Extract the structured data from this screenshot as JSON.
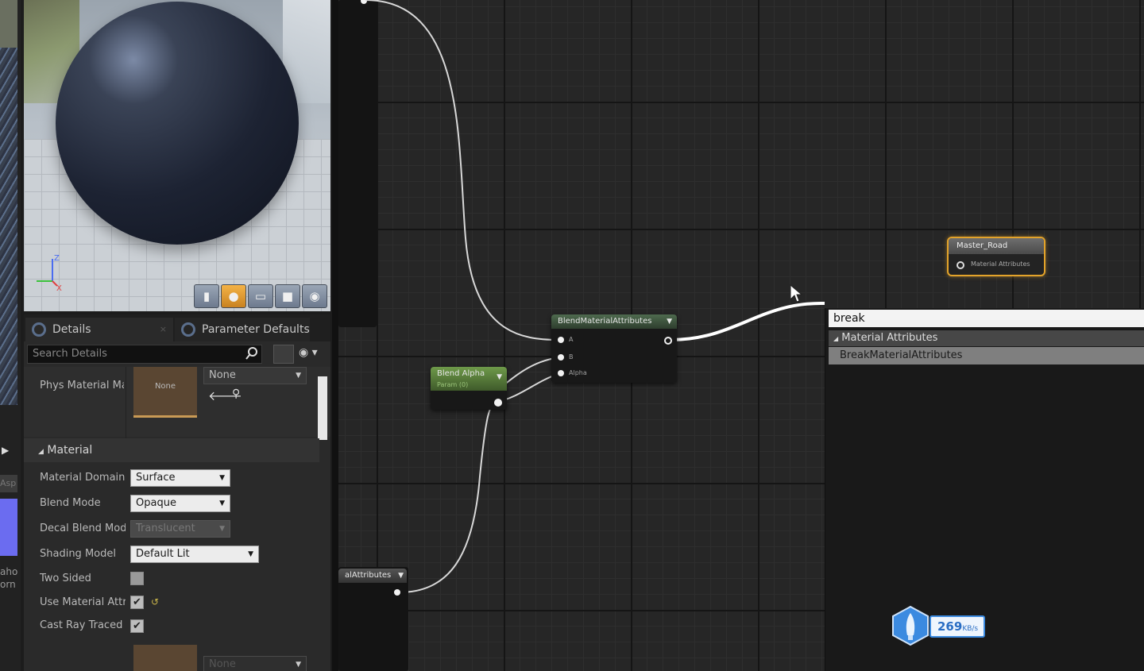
{
  "left_strip": {
    "label": "Asp",
    "text": "aho\norn"
  },
  "viewport": {
    "axis_z": "Z",
    "axis_x": "X",
    "toolbar_icons": [
      "cylinder-icon",
      "sphere-icon",
      "plane-icon",
      "cube-icon",
      "teapot-icon"
    ]
  },
  "details": {
    "tabs": [
      {
        "label": "Details"
      },
      {
        "label": "Parameter Defaults"
      }
    ],
    "search_placeholder": "Search Details",
    "phys_material": {
      "label": "Phys Material Ma",
      "thumb": "None",
      "value": "None"
    },
    "section_title": "Material",
    "properties": [
      {
        "label": "Material Domain",
        "value": "Surface"
      },
      {
        "label": "Blend Mode",
        "value": "Opaque"
      },
      {
        "label": "Decal Blend Mode",
        "value": "Translucent"
      },
      {
        "label": "Shading Model",
        "value": "Default Lit"
      },
      {
        "label": "Two Sided",
        "checked": false
      },
      {
        "label": "Use Material Attr",
        "checked": true
      },
      {
        "label": "Cast Ray Traced",
        "checked": true
      }
    ],
    "bottom_combo": "None"
  },
  "graph": {
    "blend_node": {
      "title": "BlendMaterialAttributes",
      "pins": [
        "A",
        "B",
        "Alpha"
      ]
    },
    "alpha_node": {
      "title": "Blend Alpha",
      "subtitle": "Param (0)"
    },
    "lower_node": {
      "title": "alAttributes"
    },
    "master_node": {
      "title": "Master_Road",
      "pin": "Material Attributes"
    }
  },
  "context_menu": {
    "search_value": "break",
    "category": "Material Attributes",
    "item": "BreakMaterialAttributes"
  },
  "net_widget": {
    "value": "269",
    "unit": "KB/s"
  },
  "colors": {
    "accent_orange": "#e3a32a",
    "node_green": "#4e6a4e",
    "widget_blue": "#3b8ae0"
  }
}
